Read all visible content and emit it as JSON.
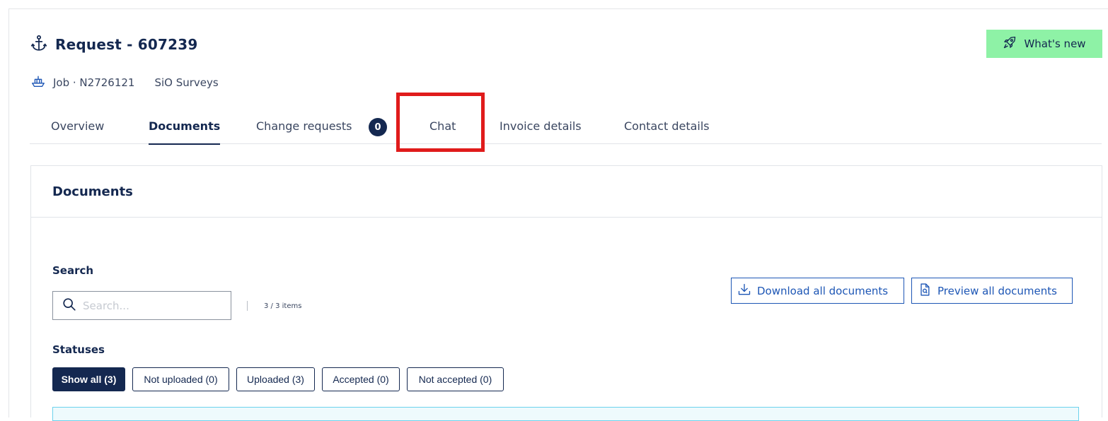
{
  "header": {
    "title": "Request - 607239",
    "whats_new_label": "What's new",
    "job_label": "Job · N2726121",
    "company": "SiO Surveys"
  },
  "tabs": [
    {
      "label": "Overview",
      "active": false
    },
    {
      "label": "Documents",
      "active": true
    },
    {
      "label": "Change requests",
      "active": false,
      "badge": "0"
    },
    {
      "label": "Chat",
      "active": false,
      "highlighted": true
    },
    {
      "label": "Invoice details",
      "active": false
    },
    {
      "label": "Contact details",
      "active": false
    }
  ],
  "documents": {
    "panel_title": "Documents",
    "search_label": "Search",
    "search_placeholder": "Search...",
    "item_count": "3 / 3 items",
    "download_all_label": "Download all documents",
    "preview_all_label": "Preview all documents",
    "statuses_label": "Statuses",
    "statuses": [
      {
        "label": "Show all (3)",
        "active": true
      },
      {
        "label": "Not uploaded (0)",
        "active": false
      },
      {
        "label": "Uploaded (3)",
        "active": false
      },
      {
        "label": "Accepted (0)",
        "active": false
      },
      {
        "label": "Not accepted (0)",
        "active": false
      }
    ]
  },
  "colors": {
    "navy": "#142850",
    "accent_blue": "#1d56b5",
    "whats_new_bg": "#8ef2a6",
    "highlight_red": "#e01b1b"
  },
  "icons": {
    "title": "anchor-icon",
    "whats_new": "rocket-icon",
    "job": "ship-icon",
    "search": "search-icon",
    "download": "download-icon",
    "preview": "document-preview-icon"
  }
}
